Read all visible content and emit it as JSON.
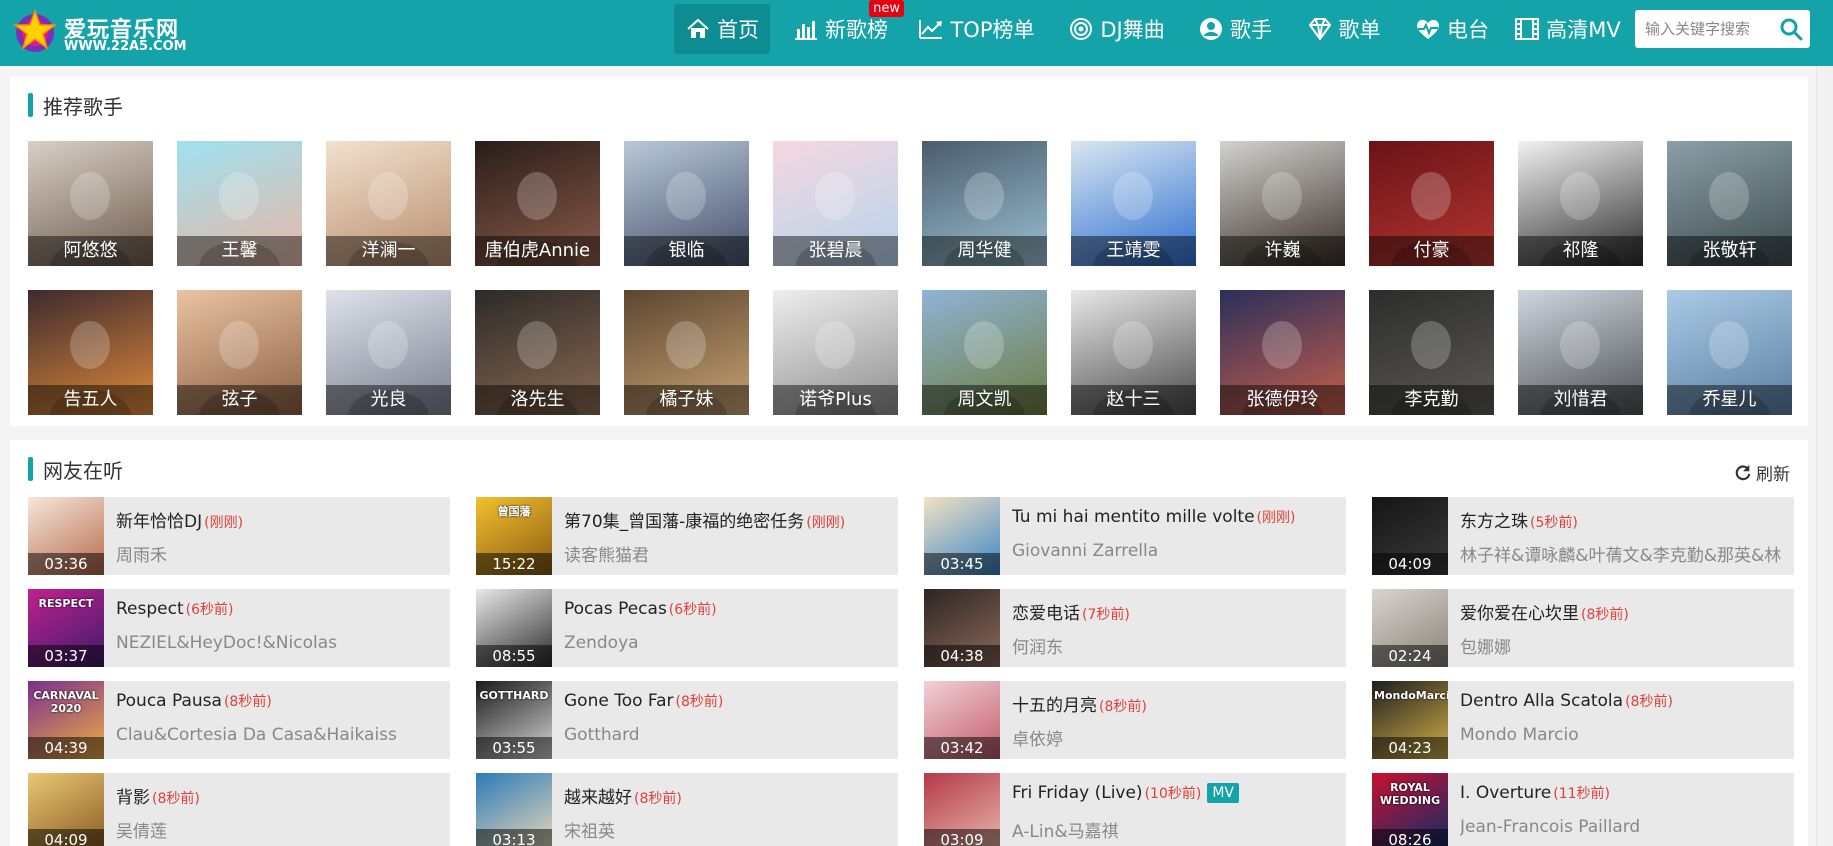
{
  "site": {
    "name": "爱玩音乐网",
    "url": "WWW.22A5.COM"
  },
  "nav": [
    {
      "label": "首页",
      "icon": "home-icon"
    },
    {
      "label": "新歌榜",
      "icon": "bar-chart-icon",
      "badge": "new"
    },
    {
      "label": "TOP榜单",
      "icon": "trending-line-icon"
    },
    {
      "label": "DJ舞曲",
      "icon": "disc-icon"
    },
    {
      "label": "歌手",
      "icon": "user-circle-icon"
    },
    {
      "label": "歌单",
      "icon": "diamond-icon"
    },
    {
      "label": "电台",
      "icon": "heartbeat-icon"
    },
    {
      "label": "高清MV",
      "icon": "film-icon"
    }
  ],
  "search": {
    "placeholder": "输入关键字搜索",
    "icon": "search-icon"
  },
  "singers": {
    "title": "推荐歌手",
    "items": [
      {
        "name": "阿悠悠",
        "colors": [
          "#d8cfc6",
          "#6e5b4c"
        ]
      },
      {
        "name": "王馨",
        "colors": [
          "#9fe1f0",
          "#e8b7a6"
        ]
      },
      {
        "name": "洋澜一",
        "colors": [
          "#f1e1cf",
          "#b98d6c"
        ]
      },
      {
        "name": "唐伯虎Annie",
        "colors": [
          "#2a1d19",
          "#8b5c4b"
        ]
      },
      {
        "name": "银临",
        "colors": [
          "#b9c8d8",
          "#44506b"
        ]
      },
      {
        "name": "张碧晨",
        "colors": [
          "#f5d7e0",
          "#b5d4ec"
        ]
      },
      {
        "name": "周华健",
        "colors": [
          "#4b5c6c",
          "#9ac0d2"
        ]
      },
      {
        "name": "王靖雯",
        "colors": [
          "#d9e6f0",
          "#2d6fd1"
        ]
      },
      {
        "name": "许巍",
        "colors": [
          "#d2d2cf",
          "#3a3028"
        ]
      },
      {
        "name": "付豪",
        "colors": [
          "#6b1218",
          "#b3362f"
        ]
      },
      {
        "name": "祁隆",
        "colors": [
          "#f2f2f2",
          "#2b2b2b"
        ]
      },
      {
        "name": "张敬轩",
        "colors": [
          "#8a9fa6",
          "#3d4c50"
        ]
      },
      {
        "name": "告五人",
        "colors": [
          "#3d2a2e",
          "#e08a3a"
        ]
      },
      {
        "name": "弦子",
        "colors": [
          "#e9c3a2",
          "#8d6043"
        ]
      },
      {
        "name": "光良",
        "colors": [
          "#dfe2ea",
          "#7a8090"
        ]
      },
      {
        "name": "洛先生",
        "colors": [
          "#2c2a28",
          "#8c6a52"
        ]
      },
      {
        "name": "橘子妹",
        "colors": [
          "#5c4630",
          "#c9a374"
        ]
      },
      {
        "name": "诺爷Plus",
        "colors": [
          "#eeeeee",
          "#8e8e8e"
        ]
      },
      {
        "name": "周文凯",
        "colors": [
          "#8fb3d6",
          "#6d7d3f"
        ]
      },
      {
        "name": "赵十三",
        "colors": [
          "#e8e8e8",
          "#4a4a4a"
        ]
      },
      {
        "name": "张德伊玲",
        "colors": [
          "#2a2f5a",
          "#c75f4a"
        ]
      },
      {
        "name": "李克勤",
        "colors": [
          "#2c2c2c",
          "#5b5a55"
        ]
      },
      {
        "name": "刘惜君",
        "colors": [
          "#cfd6de",
          "#4d4f55"
        ]
      },
      {
        "name": "乔星儿",
        "colors": [
          "#a9cbe7",
          "#5b7fa2"
        ]
      }
    ]
  },
  "listening": {
    "title": "网友在听",
    "refresh_label": "刷新",
    "songs": [
      {
        "title": "新年恰恰DJ",
        "time": "(刚刚)",
        "artist": "周雨禾",
        "duration": "03:36",
        "colors": [
          "#f5e7dc",
          "#b86a4a"
        ]
      },
      {
        "title": "第70集_曾国藩-康福的绝密任务",
        "time": "(刚刚)",
        "artist": "读客熊猫君",
        "duration": "15:22",
        "colors": [
          "#f2c12e",
          "#8a5a12"
        ],
        "cover_text": "曾国藩"
      },
      {
        "title": "Tu mi hai mentito mille volte",
        "time": "(刚刚)",
        "artist": "Giovanni Zarrella",
        "duration": "03:45",
        "colors": [
          "#f3e1c4",
          "#3a86c6"
        ]
      },
      {
        "title": "东方之珠",
        "time": "(5秒前)",
        "artist": "林子祥&谭咏麟&叶蒨文&李克勤&那英&林",
        "duration": "04:09",
        "colors": [
          "#151515",
          "#3a3a3a"
        ]
      },
      {
        "title": "Respect",
        "time": "(6秒前)",
        "artist": "NEZIEL&HeyDoc!&Nicolas",
        "duration": "03:37",
        "colors": [
          "#c1218f",
          "#3b1b6b"
        ],
        "cover_text": "RESPECT"
      },
      {
        "title": "Pocas Pecas",
        "time": "(6秒前)",
        "artist": "Zendoya",
        "duration": "08:55",
        "colors": [
          "#e9e9e9",
          "#2b2b2b"
        ]
      },
      {
        "title": "恋爱电话",
        "time": "(7秒前)",
        "artist": "何润东",
        "duration": "04:38",
        "colors": [
          "#2d2522",
          "#8c6a5b"
        ]
      },
      {
        "title": "爱你爱在心坎里",
        "time": "(8秒前)",
        "artist": "包娜娜",
        "duration": "02:24",
        "colors": [
          "#d8d4cf",
          "#8a8279"
        ]
      },
      {
        "title": "Pouca Pausa",
        "time": "(8秒前)",
        "artist": "Clau&Cortesia Da Casa&Haikaiss",
        "duration": "04:39",
        "colors": [
          "#7a2f8e",
          "#f0b040"
        ],
        "cover_text": "CARNAVAL 2020"
      },
      {
        "title": "Gone Too Far",
        "time": "(8秒前)",
        "artist": "Gotthard",
        "duration": "03:55",
        "colors": [
          "#1a1a1a",
          "#d8d8d8"
        ],
        "cover_text": "GOTTHARD"
      },
      {
        "title": "十五的月亮",
        "time": "(8秒前)",
        "artist": "卓依婷",
        "duration": "03:42",
        "colors": [
          "#f2d1d6",
          "#c25b6b"
        ]
      },
      {
        "title": "Dentro Alla Scatola",
        "time": "(8秒前)",
        "artist": "Mondo Marcio",
        "duration": "04:23",
        "colors": [
          "#1e1e1e",
          "#d6b24a"
        ],
        "cover_text": "MondoMarcio"
      },
      {
        "title": "背影",
        "time": "(8秒前)",
        "artist": "吴倩莲",
        "duration": "04:09",
        "colors": [
          "#e9c873",
          "#8a5a22"
        ]
      },
      {
        "title": "越来越好",
        "time": "(8秒前)",
        "artist": "宋祖英",
        "duration": "03:13",
        "colors": [
          "#2d7bb8",
          "#e9d9b8"
        ]
      },
      {
        "title": "Fri Friday (Live)",
        "time": "(10秒前)",
        "artist": "A-Lin&马嘉祺",
        "duration": "03:09",
        "colors": [
          "#b4384a",
          "#e9b9a9"
        ],
        "mv": "MV"
      },
      {
        "title": "I. Overture",
        "time": "(11秒前)",
        "artist": "Jean-Francois Paillard",
        "duration": "08:26",
        "colors": [
          "#c8102e",
          "#0b2d6b"
        ],
        "cover_text": "ROYAL WEDDING"
      }
    ]
  }
}
